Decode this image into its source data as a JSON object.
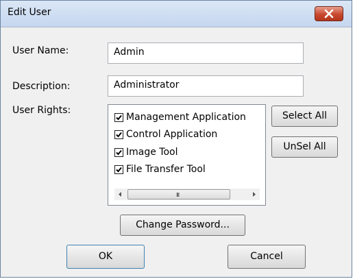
{
  "window": {
    "title": "Edit User"
  },
  "form": {
    "user_name_label": "User Name:",
    "user_name_value": "Admin",
    "description_label": "Description:",
    "description_value": "Administrator",
    "user_rights_label": "User Rights:"
  },
  "rights": [
    {
      "label": "Management Application",
      "checked": true
    },
    {
      "label": "Control Application",
      "checked": true
    },
    {
      "label": "Image Tool",
      "checked": true
    },
    {
      "label": "File Transfer Tool",
      "checked": true
    }
  ],
  "scrollbar": {
    "grip": "III"
  },
  "buttons": {
    "select_all": "Select All",
    "unselect_all": "UnSel All",
    "change_password": "Change Password...",
    "ok": "OK",
    "cancel": "Cancel"
  },
  "colors": {
    "close_button": "#c9482f",
    "titlebar": "#c5d6ef",
    "dialog_background": "#f0f0f0"
  },
  "icons": {
    "close": "close-icon",
    "checkbox": "checkmark-icon",
    "scroll_left": "scroll-left-arrow-icon",
    "scroll_right": "scroll-right-arrow-icon"
  }
}
